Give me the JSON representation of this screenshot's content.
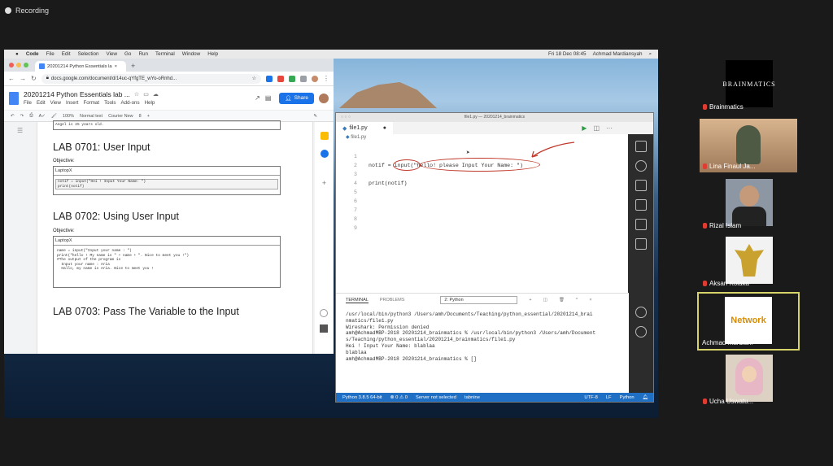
{
  "meeting": {
    "recording_label": "Recording"
  },
  "mac_menubar": {
    "items": [
      "Code",
      "File",
      "Edit",
      "Selection",
      "View",
      "Go",
      "Run",
      "Terminal",
      "Window",
      "Help"
    ],
    "clock": "Fri 18 Dec 08:45",
    "user": "Achmad Mardiansyah"
  },
  "chrome": {
    "tab_title": "20201214 Python Essentials la",
    "url": "docs.google.com/document/d/14uc-qYfgTE_wYo-oRnhd..."
  },
  "docs": {
    "title": "20201214 Python Essentials lab ...",
    "menu": [
      "File",
      "Edit",
      "View",
      "Insert",
      "Format",
      "Tools",
      "Add-ons",
      "Help"
    ],
    "share_label": "Share",
    "toolbar": {
      "zoom": "100%",
      "style": "Normal text",
      "font": "Courier New",
      "size": "8"
    },
    "top_line": "Angel is 25 years old.",
    "lab1": {
      "heading": "LAB 0701: User Input",
      "objective": "Objective:",
      "box_caption": "LaptopX",
      "code": [
        "notif = input(\"Hei ! Input Your Name: \")",
        "print(notif)"
      ]
    },
    "lab2": {
      "heading": "LAB 0702: Using User Input",
      "objective": "Objective:",
      "box_caption": "LaptopX",
      "code": [
        "name = input(\"Input your name : \")",
        "print(\"hello ! My name is \" + name + \". Nice to meet you !\")",
        "",
        "#The output of the program is",
        "  Input your name : Aria",
        "  Hallo, my name is Aria. Nice to meet you !"
      ]
    },
    "lab3": {
      "heading": "LAB 0703: Pass The Variable to the Input"
    }
  },
  "vscode": {
    "window_title": "file1.py — 20201214_brainmatics",
    "tab_name": "file1.py",
    "breadcrumb": "file1.py",
    "line_numbers": [
      "1",
      "2",
      "3",
      "4",
      "5",
      "6",
      "7",
      "8",
      "9"
    ],
    "code_lines": [
      "",
      "notif = input(\"hello! please Input Your Name: \")",
      "",
      "print(notif)",
      "",
      "",
      "",
      "",
      ""
    ],
    "panel_tabs": [
      "TERMINAL",
      "PROBLEMS"
    ],
    "terminal_select": "2: Python",
    "terminal_lines": [
      "/usr/local/bin/python3 /Users/amh/Documents/Teaching/python_essential/20201214_brai",
      "nmatics/file1.py",
      "Wireshark: Permission denied",
      "amh@AchmadMBP-2018 20201214_brainmatics % /usr/local/bin/python3 /Users/amh/Document",
      "s/Teaching/python_essential/20201214_brainmatics/file1.py",
      "Hei ! Input Your Name: blablaa",
      "blablaa",
      "amh@AchmadMBP-2018 20201214_brainmatics % []"
    ],
    "status": {
      "python": "Python 3.8.5 64-bit",
      "errors": "⊗ 0 ⚠ 0",
      "server": "Server not selected",
      "tabnine": "tabnine",
      "encoding": "UTF-8",
      "eol": "LF",
      "language": "Python"
    }
  },
  "participants": [
    {
      "name": "Brainmatics",
      "logo": "BRAINMATICS",
      "bg": "#000000"
    },
    {
      "name": "Lina Finaul Ja...",
      "bg": "#b99a7b"
    },
    {
      "name": "Rizal Islam",
      "bg": "#8d97a4"
    },
    {
      "name": "Aksan Kolaka",
      "bg": "#f2f2f2"
    },
    {
      "name": "Achmad Mardia...",
      "logo": "Network",
      "bg": "#ffffff",
      "active": true
    },
    {
      "name": "Ucha Uswatu...",
      "bg": "#d9cfc3"
    }
  ],
  "colors": {
    "annotation": "#c0392b",
    "statusbar": "#1f6fc5",
    "share": "#1a73e8",
    "active_border": "#d6d36a"
  }
}
